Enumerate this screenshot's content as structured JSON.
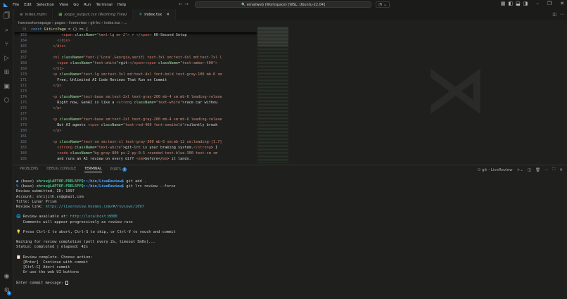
{
  "menu": [
    "File",
    "Edit",
    "Selection",
    "View",
    "Go",
    "Run",
    "Terminal",
    "Help"
  ],
  "command_center": "emailweb (Workspace) [WSL: Ubuntu-22.04]",
  "tabs": [
    {
      "label": "index.mjml",
      "icon": "file-icon"
    },
    {
      "label": "loops_output.csv (Working Tree)",
      "icon": "csv-icon"
    },
    {
      "label": "index.tsx",
      "icon": "react-icon",
      "active": true
    }
  ],
  "breadcrumb": [
    "hexmoshomepage",
    "pages",
    "livereview",
    "git-lrc",
    "index.tsx",
    "..."
  ],
  "sticky": {
    "num": "91",
    "tokens": [
      [
        "const ",
        "kw"
      ],
      [
        "GitLrcPage",
        "fn"
      ],
      [
        " = () => {",
        "txt"
      ]
    ]
  },
  "code": [
    {
      "num": "163",
      "indent": 14,
      "tokens": [
        [
          "<",
          "pun"
        ],
        [
          "span",
          "tag"
        ],
        [
          " className",
          "attr"
        ],
        [
          "=",
          "txt"
        ],
        [
          "\"text-lg mr-2\"",
          "str"
        ],
        [
          ">",
          "pun"
        ],
        [
          " ⚡ ",
          "txt"
        ],
        [
          "</",
          "pun"
        ],
        [
          "span",
          "tag"
        ],
        [
          ">",
          "pun"
        ],
        [
          " 60-Second Setup",
          "txt"
        ]
      ]
    },
    {
      "num": "164",
      "indent": 12,
      "tokens": [
        [
          "</",
          "pun"
        ],
        [
          "div",
          "tag"
        ],
        [
          ">",
          "pun"
        ]
      ]
    },
    {
      "num": "165",
      "indent": 10,
      "tokens": [
        [
          "</",
          "pun"
        ],
        [
          "div",
          "tag"
        ],
        [
          ">",
          "pun"
        ]
      ]
    },
    {
      "num": "166",
      "indent": 0,
      "tokens": []
    },
    {
      "num": "167",
      "indent": 10,
      "tokens": [
        [
          "<",
          "pun"
        ],
        [
          "h1",
          "tag"
        ],
        [
          " className",
          "attr"
        ],
        [
          "=",
          "txt"
        ],
        [
          "\"font-['Lora',Georgia,serif] text-3xl sm:text-6xl md:text-7xl l",
          "str"
        ]
      ]
    },
    {
      "num": "168",
      "indent": 12,
      "tokens": [
        [
          "<",
          "pun"
        ],
        [
          "span",
          "tag"
        ],
        [
          " className",
          "attr"
        ],
        [
          "=",
          "txt"
        ],
        [
          "\"text-white\"",
          "str"
        ],
        [
          ">git-",
          "txt"
        ],
        [
          "</",
          "pun"
        ],
        [
          "span",
          "tag"
        ],
        [
          "><",
          "pun"
        ],
        [
          "span",
          "tag"
        ],
        [
          " className",
          "attr"
        ],
        [
          "=",
          "txt"
        ],
        [
          "\"text-amber-400\"",
          "str"
        ],
        [
          ">",
          "pun"
        ]
      ]
    },
    {
      "num": "169",
      "indent": 10,
      "tokens": [
        [
          "</",
          "pun"
        ],
        [
          "h1",
          "tag"
        ],
        [
          ">",
          "pun"
        ]
      ]
    },
    {
      "num": "170",
      "indent": 10,
      "tokens": [
        [
          "<",
          "pun"
        ],
        [
          "p",
          "tag"
        ],
        [
          " className",
          "attr"
        ],
        [
          "=",
          "txt"
        ],
        [
          "\"text-lg sm:text-3xl md:text-4xl font-bold text-gray-100 mb-6 sm",
          "str"
        ]
      ]
    },
    {
      "num": "171",
      "indent": 12,
      "tokens": [
        [
          "Free, Unlimited AI Code Reviews That Run on Commit",
          "txt"
        ]
      ]
    },
    {
      "num": "172",
      "indent": 10,
      "tokens": [
        [
          "</",
          "pun"
        ],
        [
          "p",
          "tag"
        ],
        [
          ">",
          "pun"
        ]
      ]
    },
    {
      "num": "173",
      "indent": 0,
      "tokens": []
    },
    {
      "num": "174",
      "indent": 10,
      "tokens": [
        [
          "<",
          "pun"
        ],
        [
          "p",
          "tag"
        ],
        [
          " className",
          "attr"
        ],
        [
          "=",
          "txt"
        ],
        [
          "\"text-base sm:text-2xl text-gray-200 mb-4 sm:mb-6 leading-relaxe",
          "str"
        ]
      ]
    },
    {
      "num": "175",
      "indent": 12,
      "tokens": [
        [
          "Right now, GenAI is like a ",
          "txt"
        ],
        [
          "<",
          "pun"
        ],
        [
          "strong",
          "tag"
        ],
        [
          " className",
          "attr"
        ],
        [
          "=",
          "txt"
        ],
        [
          "\"text-white\"",
          "str"
        ],
        [
          ">race car withou",
          "txt"
        ]
      ]
    },
    {
      "num": "176",
      "indent": 10,
      "tokens": [
        [
          "</",
          "pun"
        ],
        [
          "p",
          "tag"
        ],
        [
          ">",
          "pun"
        ]
      ]
    },
    {
      "num": "177",
      "indent": 0,
      "tokens": []
    },
    {
      "num": "178",
      "indent": 10,
      "tokens": [
        [
          "<",
          "pun"
        ],
        [
          "p",
          "tag"
        ],
        [
          " className",
          "attr"
        ],
        [
          "=",
          "txt"
        ],
        [
          "\"text-base sm:text-2xl text-gray-200 mb-4 sm:mb-6 leading-relaxe",
          "str"
        ]
      ]
    },
    {
      "num": "179",
      "indent": 12,
      "tokens": [
        [
          "But AI agents ",
          "txt"
        ],
        [
          "<",
          "pun"
        ],
        [
          "span",
          "tag"
        ],
        [
          " className",
          "attr"
        ],
        [
          "=",
          "txt"
        ],
        [
          "\"text-red-400 font-semibold\"",
          "str"
        ],
        [
          ">silently break",
          "txt"
        ]
      ]
    },
    {
      "num": "180",
      "indent": 10,
      "tokens": [
        [
          "</",
          "pun"
        ],
        [
          "p",
          "tag"
        ],
        [
          ">",
          "pun"
        ]
      ]
    },
    {
      "num": "181",
      "indent": 0,
      "tokens": []
    },
    {
      "num": "182",
      "indent": 10,
      "tokens": [
        [
          "<",
          "pun"
        ],
        [
          "p",
          "tag"
        ],
        [
          " className",
          "attr"
        ],
        [
          "=",
          "txt"
        ],
        [
          "\"text-sm sm:text-xl text-gray-300 mb-6 sm:mb-12 sm:leading-[1.7]",
          "str"
        ]
      ]
    },
    {
      "num": "183",
      "indent": 12,
      "tokens": [
        [
          "<",
          "pun"
        ],
        [
          "strong",
          "tag"
        ],
        [
          " className",
          "attr"
        ],
        [
          "=",
          "txt"
        ],
        [
          "\"text-white\"",
          "str"
        ],
        [
          ">git-lrc is your braking system.",
          "txt"
        ],
        [
          "</",
          "pun"
        ],
        [
          "strong",
          "tag"
        ],
        [
          "> I",
          "txt"
        ]
      ]
    },
    {
      "num": "184",
      "indent": 12,
      "tokens": [
        [
          "<",
          "pun"
        ],
        [
          "code",
          "tag"
        ],
        [
          " className",
          "attr"
        ],
        [
          "=",
          "txt"
        ],
        [
          "\"bg-gray-800 px-2 py-0.5 rounded text-blue-300 text-sm sm",
          "str"
        ]
      ]
    },
    {
      "num": "185",
      "indent": 12,
      "tokens": [
        [
          "and runs an AI review on every diff ",
          "txt"
        ],
        [
          "<",
          "pun"
        ],
        [
          "em",
          "tag"
        ],
        [
          ">before</",
          "txt"
        ],
        [
          "em",
          "tag"
        ],
        [
          "> it lands.",
          "txt"
        ]
      ]
    }
  ],
  "panel": {
    "tabs": [
      "PROBLEMS",
      "DEBUG CONSOLE",
      "TERMINAL",
      "PORTS"
    ],
    "ports_badge": "1",
    "terminal_name": "git - LiveReview"
  },
  "terminal": {
    "prompt_prefix": "(base) ",
    "user": "shrsv@LAPTOP-FDEL5FFQ",
    "path": ":~/bin/LiveReview$",
    "cmd1": " git add .",
    "cmd2": " git lrc review --force",
    "lines": [
      "Review submitted, ID: 1097",
      "Account: shrijith.sv@gmail.com",
      "Title: Lunar Prism"
    ],
    "review_link_label": "Review link: ",
    "review_link": "https://livereview.hexmos.com/#/reviews/1097",
    "available_label": " Review available at: ",
    "available_url": "http://localhost:8000",
    "comments": "   Comments will appear progressively as review runs",
    "press": " Press Ctrl-C to abort, Ctrl-S to skip, or Ctrl-V to vouch and commit",
    "waiting": "Waiting for review completion (poll every 2s, timeout 5m0s)...",
    "status": "Status: completed | elapsed: 42s",
    "complete": " Review complete. Choose action:",
    "opt1": "   [Enter]  Continue with commit",
    "opt2": "   [Ctrl-C] Abort commit",
    "opt3": "   Or use the web UI buttons",
    "commit_prompt": "Enter commit message: "
  }
}
